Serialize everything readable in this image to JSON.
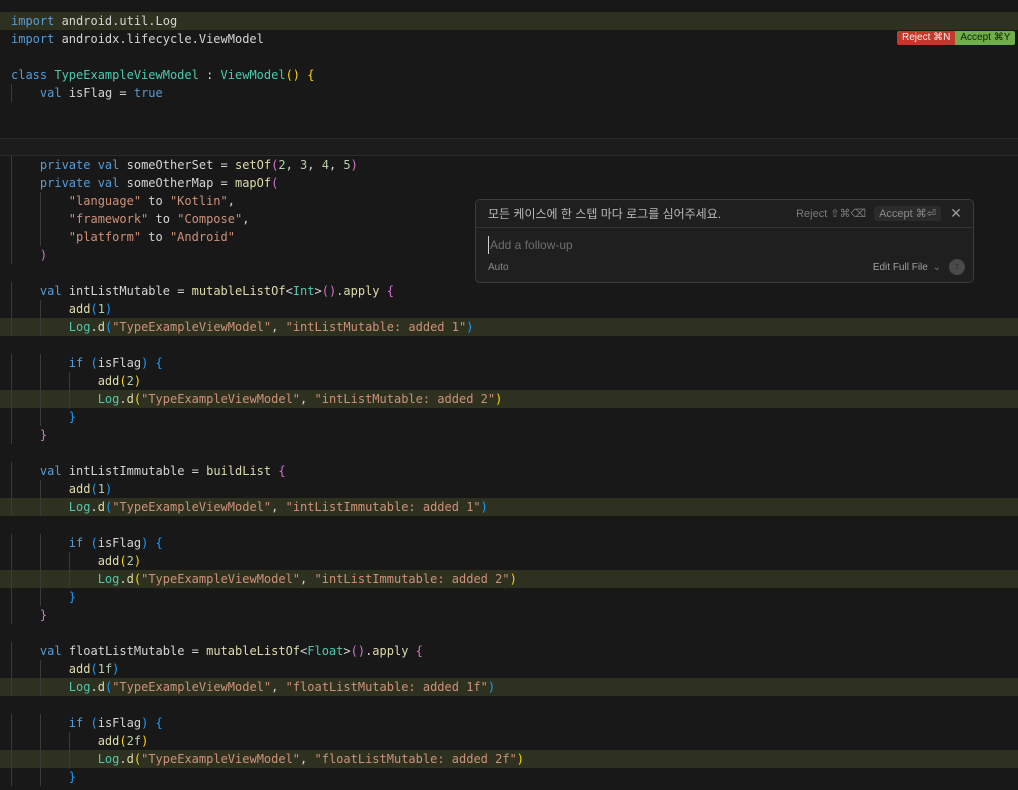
{
  "diff_actions": {
    "reject_label": "Reject ⌘N",
    "accept_label": "Accept ⌘Y"
  },
  "prompt_panel": {
    "prompt_text": "모든 케이스에 한 스텝 마다 로그를 심어주세요.",
    "reject_label": "Reject ⇧⌘⌫",
    "accept_label": "Accept ⌘⏎",
    "close_icon": "close-icon",
    "followup_placeholder": "Add a follow-up",
    "mode_label": "Auto",
    "edit_scope_label": "Edit Full File",
    "submit_icon": "arrow-up-icon"
  },
  "editor": {
    "lines": [
      {
        "indent": 0,
        "state": "added",
        "tokens": [
          [
            "kw",
            "import"
          ],
          [
            "plain",
            " android.util.Log"
          ]
        ]
      },
      {
        "indent": 0,
        "state": "",
        "tokens": [
          [
            "kw",
            "import"
          ],
          [
            "plain",
            " androidx.lifecycle.ViewModel"
          ]
        ]
      },
      {
        "indent": 0,
        "state": "",
        "tokens": []
      },
      {
        "indent": 0,
        "state": "",
        "tokens": [
          [
            "kw",
            "class"
          ],
          [
            "plain",
            " "
          ],
          [
            "type",
            "TypeExampleViewModel"
          ],
          [
            "plain",
            " : "
          ],
          [
            "type",
            "ViewModel"
          ],
          [
            "brace1",
            "()"
          ],
          [
            "plain",
            " "
          ],
          [
            "brace1",
            "{"
          ]
        ]
      },
      {
        "indent": 1,
        "state": "",
        "tokens": [
          [
            "kw",
            "val"
          ],
          [
            "plain",
            " isFlag = "
          ],
          [
            "kw",
            "true"
          ]
        ]
      },
      {
        "indent": 0,
        "state": "",
        "tokens": []
      },
      {
        "indent": 0,
        "state": "",
        "tokens": []
      },
      {
        "indent": 0,
        "state": "blank",
        "tokens": []
      },
      {
        "indent": 1,
        "state": "",
        "tokens": [
          [
            "kw",
            "private val"
          ],
          [
            "plain",
            " someOtherSet = "
          ],
          [
            "fn",
            "setOf"
          ],
          [
            "brace2",
            "("
          ],
          [
            "num",
            "2"
          ],
          [
            "plain",
            ", "
          ],
          [
            "num",
            "3"
          ],
          [
            "plain",
            ", "
          ],
          [
            "num",
            "4"
          ],
          [
            "plain",
            ", "
          ],
          [
            "num",
            "5"
          ],
          [
            "brace2",
            ")"
          ]
        ]
      },
      {
        "indent": 1,
        "state": "",
        "tokens": [
          [
            "kw",
            "private val"
          ],
          [
            "plain",
            " someOtherMap = "
          ],
          [
            "fn",
            "mapOf"
          ],
          [
            "brace2",
            "("
          ]
        ]
      },
      {
        "indent": 2,
        "state": "",
        "tokens": [
          [
            "str",
            "\"language\""
          ],
          [
            "plain",
            " to "
          ],
          [
            "str",
            "\"Kotlin\""
          ],
          [
            "plain",
            ","
          ]
        ]
      },
      {
        "indent": 2,
        "state": "",
        "tokens": [
          [
            "str",
            "\"framework\""
          ],
          [
            "plain",
            " to "
          ],
          [
            "str",
            "\"Compose\""
          ],
          [
            "plain",
            ","
          ]
        ]
      },
      {
        "indent": 2,
        "state": "",
        "tokens": [
          [
            "str",
            "\"platform\""
          ],
          [
            "plain",
            " to "
          ],
          [
            "str",
            "\"Android\""
          ]
        ]
      },
      {
        "indent": 1,
        "state": "",
        "tokens": [
          [
            "brace2",
            ")"
          ]
        ]
      },
      {
        "indent": 0,
        "state": "",
        "tokens": []
      },
      {
        "indent": 1,
        "state": "",
        "tokens": [
          [
            "kw",
            "val"
          ],
          [
            "plain",
            " intListMutable = "
          ],
          [
            "fn",
            "mutableListOf"
          ],
          [
            "plain",
            "<"
          ],
          [
            "type",
            "Int"
          ],
          [
            "plain",
            ">"
          ],
          [
            "brace2",
            "()"
          ],
          [
            "plain",
            "."
          ],
          [
            "fn",
            "apply"
          ],
          [
            "plain",
            " "
          ],
          [
            "brace2",
            "{"
          ]
        ]
      },
      {
        "indent": 2,
        "state": "",
        "tokens": [
          [
            "fn",
            "add"
          ],
          [
            "brace3",
            "("
          ],
          [
            "num",
            "1"
          ],
          [
            "brace3",
            ")"
          ]
        ]
      },
      {
        "indent": 2,
        "state": "added",
        "tokens": [
          [
            "type",
            "Log"
          ],
          [
            "plain",
            "."
          ],
          [
            "fn",
            "d"
          ],
          [
            "brace3",
            "("
          ],
          [
            "str",
            "\"TypeExampleViewModel\""
          ],
          [
            "plain",
            ", "
          ],
          [
            "str",
            "\"intListMutable: added 1\""
          ],
          [
            "brace3",
            ")"
          ]
        ]
      },
      {
        "indent": 0,
        "state": "",
        "tokens": []
      },
      {
        "indent": 2,
        "state": "",
        "tokens": [
          [
            "kw",
            "if"
          ],
          [
            "plain",
            " "
          ],
          [
            "brace3",
            "("
          ],
          [
            "plain",
            "isFlag"
          ],
          [
            "brace3",
            ")"
          ],
          [
            "plain",
            " "
          ],
          [
            "brace3",
            "{"
          ]
        ]
      },
      {
        "indent": 3,
        "state": "",
        "tokens": [
          [
            "fn",
            "add"
          ],
          [
            "brace1",
            "("
          ],
          [
            "num",
            "2"
          ],
          [
            "brace1",
            ")"
          ]
        ]
      },
      {
        "indent": 3,
        "state": "added",
        "tokens": [
          [
            "type",
            "Log"
          ],
          [
            "plain",
            "."
          ],
          [
            "fn",
            "d"
          ],
          [
            "brace1",
            "("
          ],
          [
            "str",
            "\"TypeExampleViewModel\""
          ],
          [
            "plain",
            ", "
          ],
          [
            "str",
            "\"intListMutable: added 2\""
          ],
          [
            "brace1",
            ")"
          ]
        ]
      },
      {
        "indent": 2,
        "state": "",
        "tokens": [
          [
            "brace3",
            "}"
          ]
        ]
      },
      {
        "indent": 1,
        "state": "",
        "tokens": [
          [
            "brace2",
            "}"
          ]
        ]
      },
      {
        "indent": 0,
        "state": "",
        "tokens": []
      },
      {
        "indent": 1,
        "state": "",
        "tokens": [
          [
            "kw",
            "val"
          ],
          [
            "plain",
            " intListImmutable = "
          ],
          [
            "fn",
            "buildList"
          ],
          [
            "plain",
            " "
          ],
          [
            "brace2",
            "{"
          ]
        ]
      },
      {
        "indent": 2,
        "state": "",
        "tokens": [
          [
            "fn",
            "add"
          ],
          [
            "brace3",
            "("
          ],
          [
            "num",
            "1"
          ],
          [
            "brace3",
            ")"
          ]
        ]
      },
      {
        "indent": 2,
        "state": "added",
        "tokens": [
          [
            "type",
            "Log"
          ],
          [
            "plain",
            "."
          ],
          [
            "fn",
            "d"
          ],
          [
            "brace3",
            "("
          ],
          [
            "str",
            "\"TypeExampleViewModel\""
          ],
          [
            "plain",
            ", "
          ],
          [
            "str",
            "\"intListImmutable: added 1\""
          ],
          [
            "brace3",
            ")"
          ]
        ]
      },
      {
        "indent": 0,
        "state": "",
        "tokens": []
      },
      {
        "indent": 2,
        "state": "",
        "tokens": [
          [
            "kw",
            "if"
          ],
          [
            "plain",
            " "
          ],
          [
            "brace3",
            "("
          ],
          [
            "plain",
            "isFlag"
          ],
          [
            "brace3",
            ")"
          ],
          [
            "plain",
            " "
          ],
          [
            "brace3",
            "{"
          ]
        ]
      },
      {
        "indent": 3,
        "state": "",
        "tokens": [
          [
            "fn",
            "add"
          ],
          [
            "brace1",
            "("
          ],
          [
            "num",
            "2"
          ],
          [
            "brace1",
            ")"
          ]
        ]
      },
      {
        "indent": 3,
        "state": "added",
        "tokens": [
          [
            "type",
            "Log"
          ],
          [
            "plain",
            "."
          ],
          [
            "fn",
            "d"
          ],
          [
            "brace1",
            "("
          ],
          [
            "str",
            "\"TypeExampleViewModel\""
          ],
          [
            "plain",
            ", "
          ],
          [
            "str",
            "\"intListImmutable: added 2\""
          ],
          [
            "brace1",
            ")"
          ]
        ]
      },
      {
        "indent": 2,
        "state": "",
        "tokens": [
          [
            "brace3",
            "}"
          ]
        ]
      },
      {
        "indent": 1,
        "state": "",
        "tokens": [
          [
            "brace2",
            "}"
          ]
        ]
      },
      {
        "indent": 0,
        "state": "",
        "tokens": []
      },
      {
        "indent": 1,
        "state": "",
        "tokens": [
          [
            "kw",
            "val"
          ],
          [
            "plain",
            " floatListMutable = "
          ],
          [
            "fn",
            "mutableListOf"
          ],
          [
            "plain",
            "<"
          ],
          [
            "type",
            "Float"
          ],
          [
            "plain",
            ">"
          ],
          [
            "brace2",
            "()"
          ],
          [
            "plain",
            "."
          ],
          [
            "fn",
            "apply"
          ],
          [
            "plain",
            " "
          ],
          [
            "brace2",
            "{"
          ]
        ]
      },
      {
        "indent": 2,
        "state": "",
        "tokens": [
          [
            "fn",
            "add"
          ],
          [
            "brace3",
            "("
          ],
          [
            "num",
            "1f"
          ],
          [
            "brace3",
            ")"
          ]
        ]
      },
      {
        "indent": 2,
        "state": "added",
        "tokens": [
          [
            "type",
            "Log"
          ],
          [
            "plain",
            "."
          ],
          [
            "fn",
            "d"
          ],
          [
            "brace3",
            "("
          ],
          [
            "str",
            "\"TypeExampleViewModel\""
          ],
          [
            "plain",
            ", "
          ],
          [
            "str",
            "\"floatListMutable: added 1f\""
          ],
          [
            "brace3",
            ")"
          ]
        ]
      },
      {
        "indent": 0,
        "state": "",
        "tokens": []
      },
      {
        "indent": 2,
        "state": "",
        "tokens": [
          [
            "kw",
            "if"
          ],
          [
            "plain",
            " "
          ],
          [
            "brace3",
            "("
          ],
          [
            "plain",
            "isFlag"
          ],
          [
            "brace3",
            ")"
          ],
          [
            "plain",
            " "
          ],
          [
            "brace3",
            "{"
          ]
        ]
      },
      {
        "indent": 3,
        "state": "",
        "tokens": [
          [
            "fn",
            "add"
          ],
          [
            "brace1",
            "("
          ],
          [
            "num",
            "2f"
          ],
          [
            "brace1",
            ")"
          ]
        ]
      },
      {
        "indent": 3,
        "state": "added",
        "tokens": [
          [
            "type",
            "Log"
          ],
          [
            "plain",
            "."
          ],
          [
            "fn",
            "d"
          ],
          [
            "brace1",
            "("
          ],
          [
            "str",
            "\"TypeExampleViewModel\""
          ],
          [
            "plain",
            ", "
          ],
          [
            "str",
            "\"floatListMutable: added 2f\""
          ],
          [
            "brace1",
            ")"
          ]
        ]
      },
      {
        "indent": 2,
        "state": "",
        "tokens": [
          [
            "brace3",
            "}"
          ]
        ]
      }
    ]
  }
}
